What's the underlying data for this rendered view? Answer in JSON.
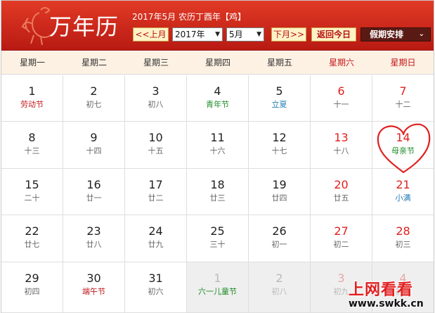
{
  "header": {
    "brand": "万年历",
    "info": "2017年5月 农历丁酉年【鸡】",
    "prev_month": "<<上月",
    "year_value": "2017年",
    "month_value": "5月",
    "next_month": "下月>>",
    "today": "返回今日",
    "holiday": "假期安排",
    "dropdown_icon": "caret-down-icon"
  },
  "weekdays": [
    "星期一",
    "星期二",
    "星期三",
    "星期四",
    "星期五",
    "星期六",
    "星期日"
  ],
  "days": [
    [
      {
        "n": "1",
        "s": "劳动节",
        "sc": "red"
      },
      {
        "n": "2",
        "s": "初七"
      },
      {
        "n": "3",
        "s": "初八"
      },
      {
        "n": "4",
        "s": "青年节",
        "sc": "green"
      },
      {
        "n": "5",
        "s": "立夏",
        "sc": "blue"
      },
      {
        "n": "6",
        "s": "十一",
        "nc": "red"
      },
      {
        "n": "7",
        "s": "十二",
        "nc": "red"
      }
    ],
    [
      {
        "n": "8",
        "s": "十三"
      },
      {
        "n": "9",
        "s": "十四"
      },
      {
        "n": "10",
        "s": "十五"
      },
      {
        "n": "11",
        "s": "十六"
      },
      {
        "n": "12",
        "s": "十七"
      },
      {
        "n": "13",
        "s": "十八",
        "nc": "red"
      },
      {
        "n": "14",
        "s": "母亲节",
        "nc": "red",
        "sc": "green"
      }
    ],
    [
      {
        "n": "15",
        "s": "二十"
      },
      {
        "n": "16",
        "s": "廿一"
      },
      {
        "n": "17",
        "s": "廿二"
      },
      {
        "n": "18",
        "s": "廿三"
      },
      {
        "n": "19",
        "s": "廿四"
      },
      {
        "n": "20",
        "s": "廿五",
        "nc": "red"
      },
      {
        "n": "21",
        "s": "小满",
        "nc": "red",
        "sc": "blue"
      }
    ],
    [
      {
        "n": "22",
        "s": "廿七"
      },
      {
        "n": "23",
        "s": "廿八"
      },
      {
        "n": "24",
        "s": "廿九"
      },
      {
        "n": "25",
        "s": "三十"
      },
      {
        "n": "26",
        "s": "初一"
      },
      {
        "n": "27",
        "s": "初二",
        "nc": "red"
      },
      {
        "n": "28",
        "s": "初三",
        "nc": "red"
      }
    ],
    [
      {
        "n": "29",
        "s": "初四"
      },
      {
        "n": "30",
        "s": "端午节",
        "sc": "red"
      },
      {
        "n": "31",
        "s": "初六"
      },
      {
        "n": "1",
        "s": "六一儿童节",
        "sc": "green",
        "g": true
      },
      {
        "n": "2",
        "s": "初八",
        "g": true
      },
      {
        "n": "3",
        "s": "初九",
        "nc": "red",
        "g": true
      },
      {
        "n": "4",
        "s": "初十",
        "nc": "red",
        "g": true
      }
    ]
  ],
  "watermark": {
    "cn": "上网看看",
    "url": "www.swkk.cn"
  },
  "colors": {
    "header_red": "#c8241a",
    "weekday_bg": "#fdf1e3",
    "holiday_red": "#c3171a",
    "festival_green": "#1a8a23",
    "solar_blue": "#1f7bb2"
  }
}
